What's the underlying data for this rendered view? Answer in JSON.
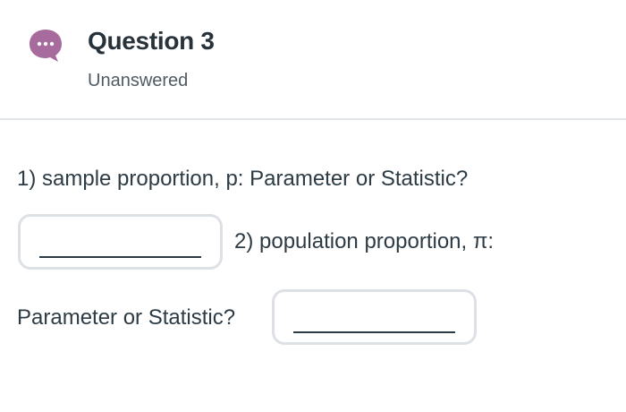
{
  "question": {
    "title": "Question 3",
    "status": "Unanswered",
    "bubble_icon": "speech-bubble-ellipsis-icon",
    "accent_color": "#a76b9d"
  },
  "content": {
    "part1": "1) sample proportion, p: Parameter or Statistic?",
    "part2": "2) population proportion, π:",
    "part3": "Parameter or Statistic?",
    "answer1_value": "",
    "answer2_value": ""
  }
}
